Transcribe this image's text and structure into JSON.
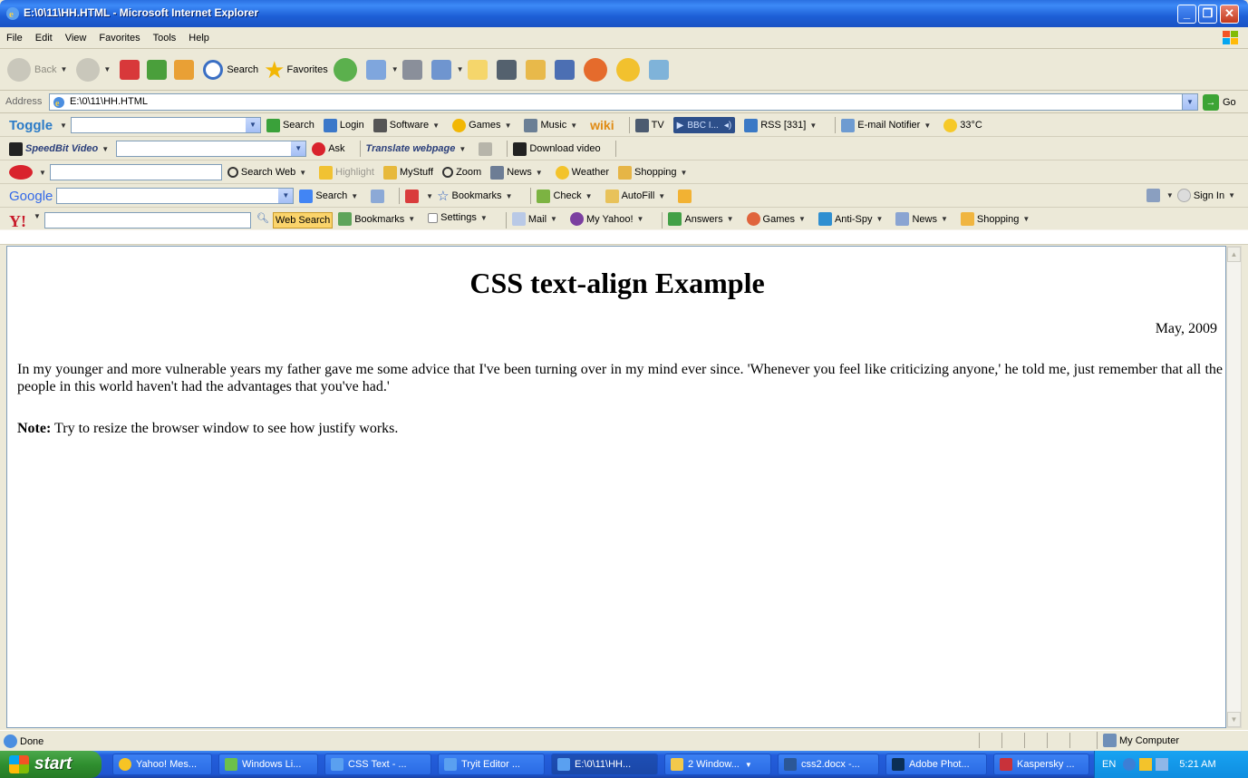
{
  "window": {
    "title": "E:\\0\\11\\HH.HTML - Microsoft Internet Explorer"
  },
  "menu": [
    "File",
    "Edit",
    "View",
    "Favorites",
    "Tools",
    "Help"
  ],
  "std_toolbar": {
    "back": "Back",
    "search": "Search",
    "favorites": "Favorites"
  },
  "address": {
    "label": "Address",
    "value": "E:\\0\\11\\HH.HTML",
    "go": "Go"
  },
  "toggle_bar": {
    "brand": "Toggle",
    "search": "Search",
    "login": "Login",
    "software": "Software",
    "games": "Games",
    "music": "Music",
    "wiki": "wiki",
    "tv": "TV",
    "player": "BBC I...",
    "rss": "RSS [331]",
    "email": "E-mail Notifier",
    "temp": "33°C"
  },
  "speedbit_bar": {
    "brand": "SpeedBit Video",
    "ask": "Ask",
    "translate": "Translate webpage",
    "download": "Download video"
  },
  "ask_bar": {
    "search_web": "Search Web",
    "highlight": "Highlight",
    "mystuff": "MyStuff",
    "zoom": "Zoom",
    "news": "News",
    "weather": "Weather",
    "shopping": "Shopping"
  },
  "google_bar": {
    "brand": "Google",
    "search": "Search",
    "bookmarks": "Bookmarks",
    "check": "Check",
    "autofill": "AutoFill",
    "signin": "Sign In"
  },
  "yahoo_bar": {
    "brand": "Y!",
    "web_search": "Web Search",
    "bookmarks": "Bookmarks",
    "settings": "Settings",
    "mail": "Mail",
    "my_yahoo": "My Yahoo!",
    "answers": "Answers",
    "games": "Games",
    "antispy": "Anti-Spy",
    "news": "News",
    "shopping": "Shopping"
  },
  "page": {
    "heading": "CSS text-align Example",
    "date": "May, 2009",
    "paragraph": "In my younger and more vulnerable years my father gave me some advice that I've been turning over in my mind ever since. 'Whenever you feel like criticizing anyone,' he told me, just remember that all the people in this world haven't had the advantages that you've had.'",
    "note_label": "Note:",
    "note_text": " Try to resize the browser window to see how justify works."
  },
  "status": {
    "text": "Done",
    "zone": "My Computer"
  },
  "taskbar": {
    "start": "start",
    "tasks": [
      "Yahoo! Mes...",
      "Windows Li...",
      "CSS Text - ...",
      "Tryit Editor ...",
      "E:\\0\\11\\HH...",
      "2 Window...",
      "css2.docx -...",
      "Adobe Phot...",
      "Kaspersky ..."
    ],
    "lang": "EN",
    "clock": "5:21 AM"
  }
}
